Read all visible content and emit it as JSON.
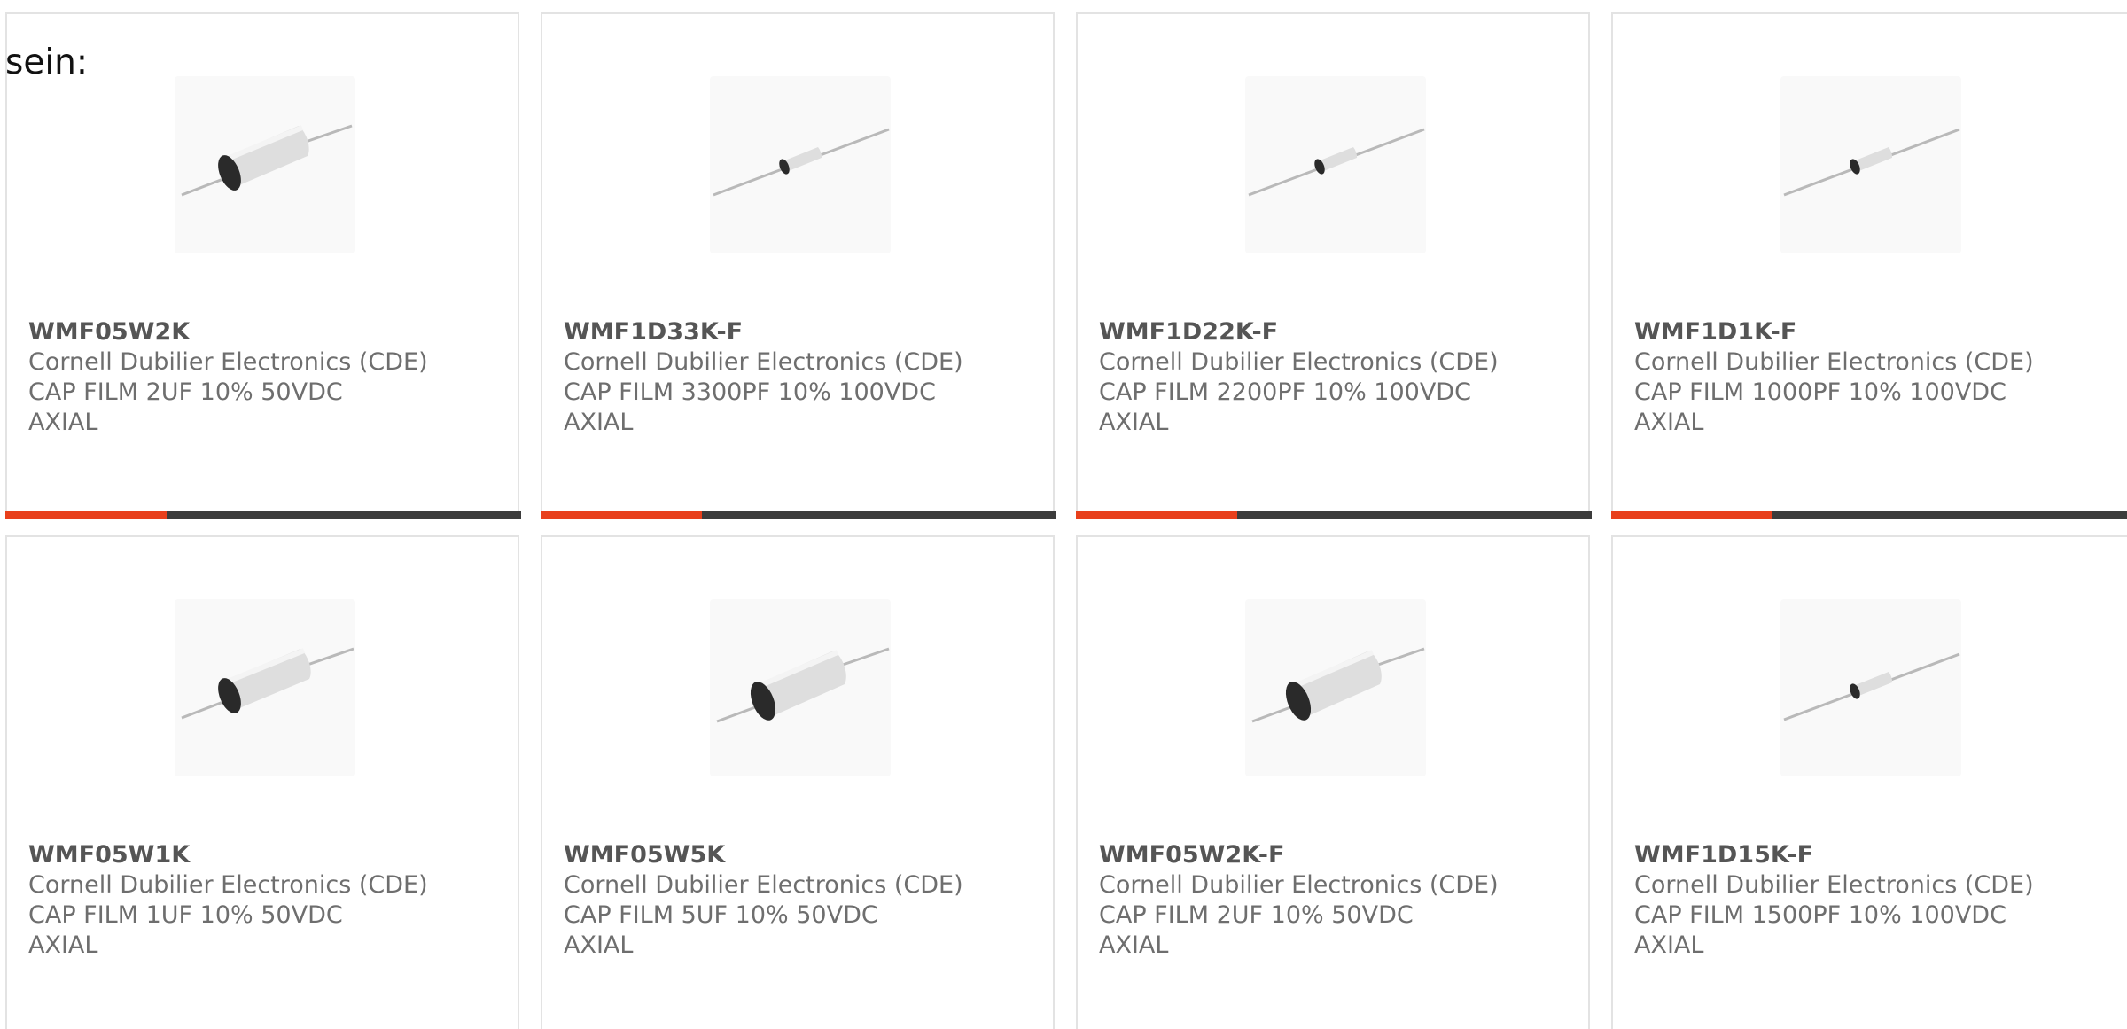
{
  "intro_text": "sein:",
  "colors": {
    "accent": "#e8401c",
    "bar_dark": "#3c3c3c",
    "card_border": "#e3e3e3"
  },
  "products": [
    {
      "part_number": "WMF05W2K",
      "manufacturer": "Cornell Dubilier Electronics (CDE)",
      "description": "CAP FILM 2UF 10% 50VDC AXIAL",
      "image_icon": "axial-film-capacitor-large-icon"
    },
    {
      "part_number": "WMF1D33K-F",
      "manufacturer": "Cornell Dubilier Electronics (CDE)",
      "description": "CAP FILM 3300PF 10% 100VDC AXIAL",
      "image_icon": "axial-film-capacitor-small-icon"
    },
    {
      "part_number": "WMF1D22K-F",
      "manufacturer": "Cornell Dubilier Electronics (CDE)",
      "description": "CAP FILM 2200PF 10% 100VDC AXIAL",
      "image_icon": "axial-film-capacitor-small-icon"
    },
    {
      "part_number": "WMF1D1K-F",
      "manufacturer": "Cornell Dubilier Electronics (CDE)",
      "description": "CAP FILM 1000PF 10% 100VDC AXIAL",
      "image_icon": "axial-film-capacitor-small-icon"
    },
    {
      "part_number": "WMF05W1K",
      "manufacturer": "Cornell Dubilier Electronics (CDE)",
      "description": "CAP FILM 1UF 10% 50VDC AXIAL",
      "image_icon": "axial-film-capacitor-large-icon"
    },
    {
      "part_number": "WMF05W5K",
      "manufacturer": "Cornell Dubilier Electronics (CDE)",
      "description": "CAP FILM 5UF 10% 50VDC AXIAL",
      "image_icon": "axial-film-capacitor-large-icon"
    },
    {
      "part_number": "WMF05W2K-F",
      "manufacturer": "Cornell Dubilier Electronics (CDE)",
      "description": "CAP FILM 2UF 10% 50VDC AXIAL",
      "image_icon": "axial-film-capacitor-large-icon"
    },
    {
      "part_number": "WMF1D15K-F",
      "manufacturer": "Cornell Dubilier Electronics (CDE)",
      "description": "CAP FILM 1500PF 10% 100VDC AXIAL",
      "image_icon": "axial-film-capacitor-small-icon"
    }
  ]
}
